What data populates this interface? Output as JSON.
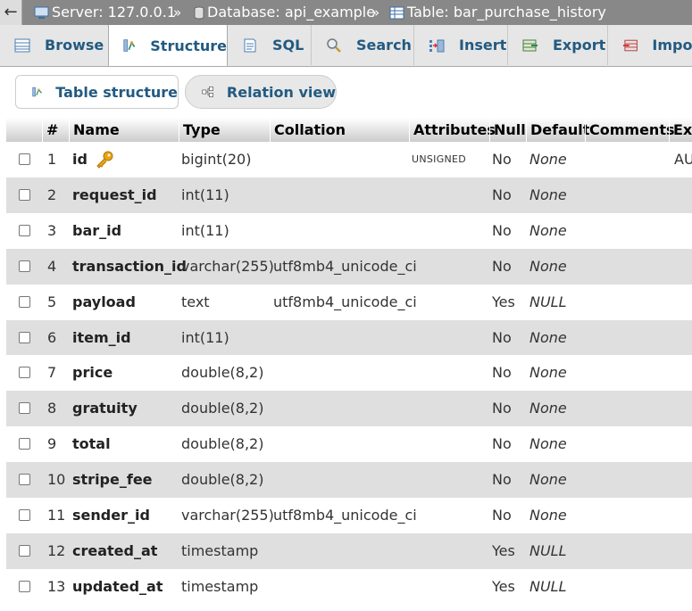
{
  "breadcrumb": {
    "back_glyph": "←",
    "server": "Server: 127.0.0.1",
    "separator": "»",
    "database": "Database: api_example",
    "table": "Table: bar_purchase_history"
  },
  "tabs": [
    {
      "label": "Browse",
      "icon": "browse-icon"
    },
    {
      "label": "Structure",
      "icon": "structure-icon",
      "active": true
    },
    {
      "label": "SQL",
      "icon": "sql-icon"
    },
    {
      "label": "Search",
      "icon": "search-icon"
    },
    {
      "label": "Insert",
      "icon": "insert-icon"
    },
    {
      "label": "Export",
      "icon": "export-icon"
    },
    {
      "label": "Import",
      "icon": "import-icon"
    }
  ],
  "subtabs": [
    {
      "label": "Table structure",
      "icon": "table-structure-icon"
    },
    {
      "label": "Relation view",
      "icon": "relation-view-icon"
    }
  ],
  "table": {
    "headers": {
      "num": "#",
      "name": "Name",
      "type": "Type",
      "collation": "Collation",
      "attributes": "Attributes",
      "null": "Null",
      "default": "Default",
      "comments": "Comments",
      "extra": "Ex"
    },
    "rows": [
      {
        "num": "1",
        "name": "id",
        "primary_key": true,
        "type": "bigint(20)",
        "collation": "",
        "attributes": "UNSIGNED",
        "null": "No",
        "default": "None",
        "extra": "AU"
      },
      {
        "num": "2",
        "name": "request_id",
        "type": "int(11)",
        "collation": "",
        "attributes": "",
        "null": "No",
        "default": "None",
        "extra": ""
      },
      {
        "num": "3",
        "name": "bar_id",
        "type": "int(11)",
        "collation": "",
        "attributes": "",
        "null": "No",
        "default": "None",
        "extra": ""
      },
      {
        "num": "4",
        "name": "transaction_id",
        "type": "varchar(255)",
        "collation": "utf8mb4_unicode_ci",
        "attributes": "",
        "null": "No",
        "default": "None",
        "extra": ""
      },
      {
        "num": "5",
        "name": "payload",
        "type": "text",
        "collation": "utf8mb4_unicode_ci",
        "attributes": "",
        "null": "Yes",
        "default": "NULL",
        "extra": ""
      },
      {
        "num": "6",
        "name": "item_id",
        "type": "int(11)",
        "collation": "",
        "attributes": "",
        "null": "No",
        "default": "None",
        "extra": ""
      },
      {
        "num": "7",
        "name": "price",
        "type": "double(8,2)",
        "collation": "",
        "attributes": "",
        "null": "No",
        "default": "None",
        "extra": ""
      },
      {
        "num": "8",
        "name": "gratuity",
        "type": "double(8,2)",
        "collation": "",
        "attributes": "",
        "null": "No",
        "default": "None",
        "extra": ""
      },
      {
        "num": "9",
        "name": "total",
        "type": "double(8,2)",
        "collation": "",
        "attributes": "",
        "null": "No",
        "default": "None",
        "extra": ""
      },
      {
        "num": "10",
        "name": "stripe_fee",
        "type": "double(8,2)",
        "collation": "",
        "attributes": "",
        "null": "No",
        "default": "None",
        "extra": ""
      },
      {
        "num": "11",
        "name": "sender_id",
        "type": "varchar(255)",
        "collation": "utf8mb4_unicode_ci",
        "attributes": "",
        "null": "No",
        "default": "None",
        "extra": ""
      },
      {
        "num": "12",
        "name": "created_at",
        "type": "timestamp",
        "collation": "",
        "attributes": "",
        "null": "Yes",
        "default": "NULL",
        "extra": ""
      },
      {
        "num": "13",
        "name": "updated_at",
        "type": "timestamp",
        "collation": "",
        "attributes": "",
        "null": "Yes",
        "default": "NULL",
        "extra": ""
      }
    ]
  },
  "colors": {
    "link": "#235a81",
    "breadcrumb_bg": "#888888",
    "row_alt": "#dfdfdf",
    "key_icon": "#e8a317"
  }
}
